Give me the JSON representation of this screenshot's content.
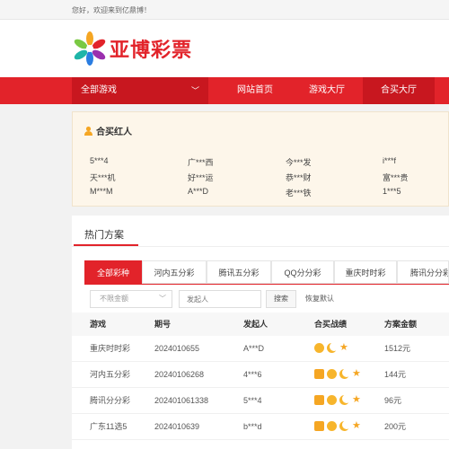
{
  "topbar": {
    "greeting": "您好，欢迎来到亿鼎博！"
  },
  "logo": {
    "text": "亚博彩票"
  },
  "nav": {
    "all_games": "全部游戏",
    "items": [
      {
        "label": "网站首页"
      },
      {
        "label": "游戏大厅"
      },
      {
        "label": "合买大厅"
      }
    ]
  },
  "winners": {
    "title": "合买红人",
    "names": [
      "5***4",
      "广***西",
      "今***发",
      "i***f",
      "天***机",
      "好***运",
      "恭***财",
      "富***贵",
      "M***M",
      "A***D",
      "老***铁",
      "1***5"
    ]
  },
  "hot": {
    "title": "热门方案",
    "tabs": [
      "全部彩种",
      "河内五分彩",
      "腾讯五分彩",
      "QQ分分彩",
      "重庆时时彩",
      "腾讯分分彩"
    ],
    "filter": {
      "amount_select": "不限金额",
      "initiator_placeholder": "发起人",
      "search_label": "搜索",
      "reset_label": "恢复默认"
    },
    "columns": [
      "游戏",
      "期号",
      "发起人",
      "合买战绩",
      "方案金额"
    ],
    "rows": [
      {
        "game": "重庆时时彩",
        "issue": "2024010655",
        "initiator": "A***D",
        "badges": [
          "sun",
          "moon",
          "star"
        ],
        "amount": "1512元"
      },
      {
        "game": "河内五分彩",
        "issue": "2024010626​8",
        "initiator": "4***6",
        "badges": [
          "crown",
          "sun",
          "moon",
          "star"
        ],
        "amount": "144元"
      },
      {
        "game": "腾讯分分彩",
        "issue": "2024010613​38",
        "initiator": "5***4",
        "badges": [
          "crown",
          "sun",
          "moon",
          "star"
        ],
        "amount": "96元"
      },
      {
        "game": "广东11选5",
        "issue": "2024010639",
        "initiator": "b***d",
        "badges": [
          "crown",
          "sun",
          "moon",
          "star"
        ],
        "amount": "200元"
      }
    ]
  },
  "colors": {
    "brand_red": "#e2232a",
    "dark_red": "#c8171f",
    "gold": "#f5a623"
  }
}
